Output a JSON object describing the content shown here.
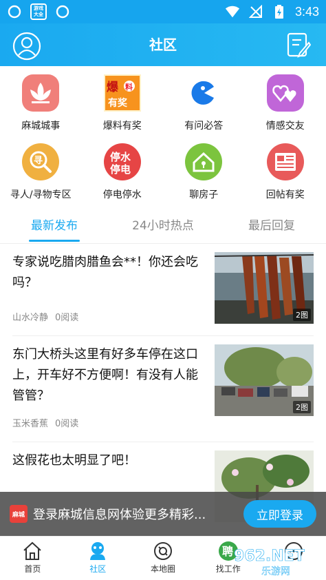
{
  "statusbar": {
    "time": "3:43",
    "left_icons": [
      "sync-icon",
      "game-box-icon",
      "sync-icon"
    ],
    "game_box_text": "游戏\n大全",
    "right_icons": [
      "wifi-icon",
      "no-signal-icon",
      "battery-charging-icon"
    ]
  },
  "appbar": {
    "title": "社区"
  },
  "categories": [
    {
      "label": "麻城城事",
      "icon": "city-lotus-icon",
      "color": "#f07f7a"
    },
    {
      "label": "爆料有奖",
      "icon": "tipoff-award-icon",
      "color": "#f7931e",
      "icon_text": "爆料\n有奖"
    },
    {
      "label": "有问必答",
      "icon": "pacman-question-icon",
      "color": "#1a7ae8"
    },
    {
      "label": "情感交友",
      "icon": "hearts-icon",
      "color": "#c066d8"
    },
    {
      "label": "寻人/寻物专区",
      "icon": "search-person-icon",
      "color": "#f0b040",
      "icon_text": "寻"
    },
    {
      "label": "停电停水",
      "icon": "power-water-outage-icon",
      "color": "#e64545",
      "icon_text": "停水\n停电"
    },
    {
      "label": "聊房子",
      "icon": "house-icon",
      "color": "#7cc43e"
    },
    {
      "label": "回帖有奖",
      "icon": "newspaper-icon",
      "color": "#e85a5a"
    }
  ],
  "tabs": [
    {
      "label": "最新发布",
      "active": true
    },
    {
      "label": "24小时热点",
      "active": false
    },
    {
      "label": "最后回复",
      "active": false
    }
  ],
  "posts": [
    {
      "title": "专家说吃腊肉腊鱼会**！你还会吃吗？",
      "author": "山水冷静",
      "reads": "0阅读",
      "img_count": "2图"
    },
    {
      "title": "东门大桥头这里有好多车停在这口上，开车好不方便啊！有没有人能管管？",
      "author": "玉米香蕉",
      "reads": "0阅读",
      "img_count": "2图"
    },
    {
      "title": "这假花也太明显了吧！",
      "author": "",
      "reads": "",
      "img_count": ""
    }
  ],
  "banner": {
    "logo_text": "麻城",
    "text": "登录麻城信息网体验更多精彩...",
    "button": "立即登录"
  },
  "bottomnav": [
    {
      "label": "首页",
      "icon": "home-icon",
      "active": false
    },
    {
      "label": "社区",
      "icon": "community-icon",
      "active": true
    },
    {
      "label": "本地圈",
      "icon": "local-circle-icon",
      "active": false
    },
    {
      "label": "找工作",
      "icon": "job-icon",
      "active": false,
      "icon_text": "聘"
    },
    {
      "label": "",
      "icon": "more-icon",
      "active": false
    }
  ],
  "watermark": {
    "line1": "962.NET",
    "line2": "乐游网"
  },
  "colors": {
    "primary": "#1aa9f0"
  }
}
